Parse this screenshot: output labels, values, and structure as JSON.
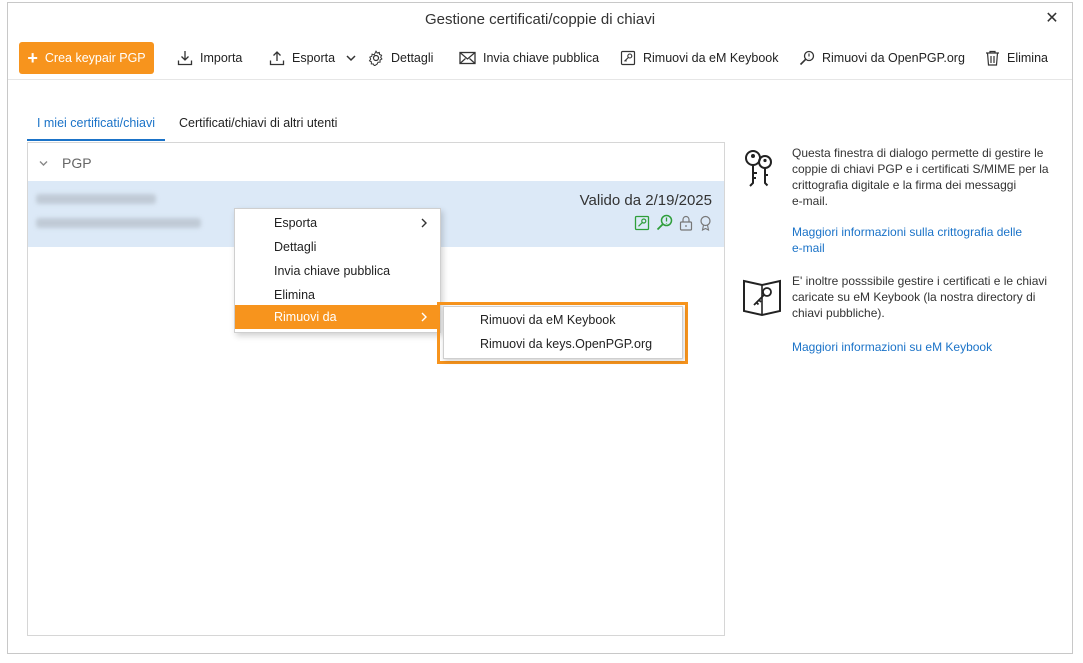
{
  "window": {
    "title": "Gestione certificati/coppie di chiavi",
    "close_glyph": "✕"
  },
  "toolbar": {
    "create_label": "Crea keypair PGP",
    "import_label": "Importa",
    "export_label": "Esporta",
    "details_label": "Dettagli",
    "send_key_label": "Invia chiave pubblica",
    "remove_keybook_label": "Rimuovi da eM Keybook",
    "remove_openpgp_label": "Rimuovi da OpenPGP.org",
    "delete_label": "Elimina"
  },
  "tabs": [
    {
      "label": "I miei certificati/chiavi",
      "active": true
    },
    {
      "label": "Certificati/chiavi di altri utenti",
      "active": false
    }
  ],
  "list": {
    "group_label": "PGP",
    "rows": [
      {
        "valid_text": "Valido da 2/19/2025"
      }
    ]
  },
  "context_menu": {
    "items": [
      {
        "label": "Esporta",
        "has_submenu": true
      },
      {
        "label": "Dettagli",
        "has_submenu": false
      },
      {
        "label": "Invia chiave pubblica",
        "has_submenu": false
      },
      {
        "label": "Elimina",
        "has_submenu": false
      },
      {
        "label": "Rimuovi da",
        "has_submenu": true,
        "highlighted": true
      }
    ],
    "submenu": [
      {
        "label": "Rimuovi da eM Keybook"
      },
      {
        "label": "Rimuovi da keys.OpenPGP.org"
      }
    ]
  },
  "side_panel": {
    "block1_lines": [
      "Questa finestra di dialogo permette di gestire le",
      "coppie di chiavi PGP e i certificati S/MIME per la",
      "crittografia digitale e la firma dei messaggi",
      "e-mail."
    ],
    "block1_link_lines": [
      "Maggiori informazioni sulla crittografia delle",
      "e-mail"
    ],
    "block2_lines": [
      "E' inoltre posssibile gestire i certificati e le chiavi",
      "caricate su eM Keybook (la nostra directory di",
      "chiavi pubbliche)."
    ],
    "block2_link": "Maggiori informazioni su eM Keybook"
  },
  "colors": {
    "accent": "#f7941d",
    "link": "#1b73c8",
    "selection": "#dce9f7",
    "status_green": "#2e9e3a"
  }
}
